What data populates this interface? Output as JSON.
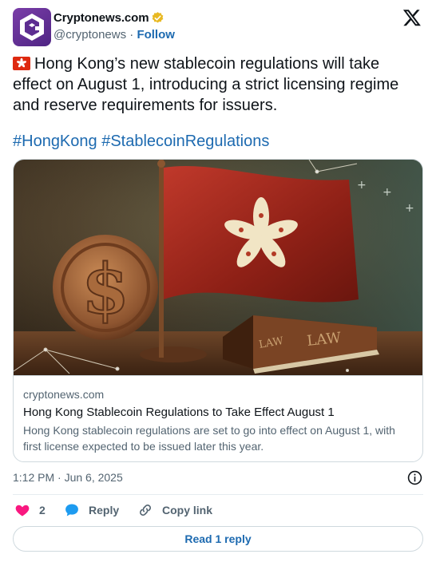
{
  "account": {
    "display_name": "Cryptonews.com",
    "handle": "@cryptonews",
    "separator": "·",
    "follow_label": "Follow",
    "verified_color": "#e8b923"
  },
  "tweet": {
    "emoji": "hong-kong-flag",
    "text": "Hong Kong’s new stablecoin regulations will take effect on August 1, introducing a strict licensing regime and reserve requirements for issuers.",
    "hashtags": [
      "#HongKong",
      "#StablecoinRegulations"
    ]
  },
  "card": {
    "image_description_icon": "hong-kong-flag-coin-law-book",
    "domain": "cryptonews.com",
    "title": "Hong Kong Stablecoin Regulations to Take Effect August 1",
    "description": "Hong Kong stablecoin regulations are set to go into effect on August 1, with first license expected to be issued later this year."
  },
  "meta": {
    "timestamp": "1:12 PM · Jun 6, 2025"
  },
  "actions": {
    "like_count": "2",
    "reply_label": "Reply",
    "copy_label": "Copy link"
  },
  "footer": {
    "read_reply_label": "Read 1 reply"
  },
  "colors": {
    "link_blue": "#1d6ab0",
    "like_pink": "#f91880",
    "reply_blue": "#1d9bf0",
    "muted": "#536471"
  }
}
